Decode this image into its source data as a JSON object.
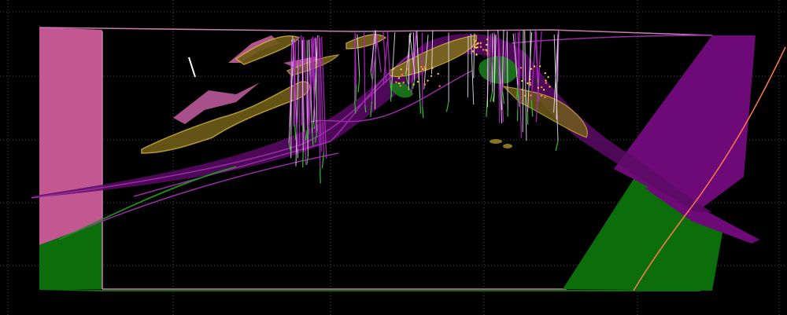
{
  "view": {
    "type": "3d-geological-model-viewport",
    "background": "#000000",
    "grid_color": "#4a4a4a",
    "grid": true
  },
  "colors": {
    "pink_block": "#cc5c99",
    "green_block": "#0b6e0b",
    "purple_surface": "#6e0a78",
    "purple_line": "#9a2aa8",
    "gold_body": "#8a7420",
    "gold_outline": "#c8a83a",
    "drillhole_white": "#ffffff",
    "drillhole_green": "#2cbf2c",
    "fault_trace": "#ff7a4a"
  },
  "legend": []
}
